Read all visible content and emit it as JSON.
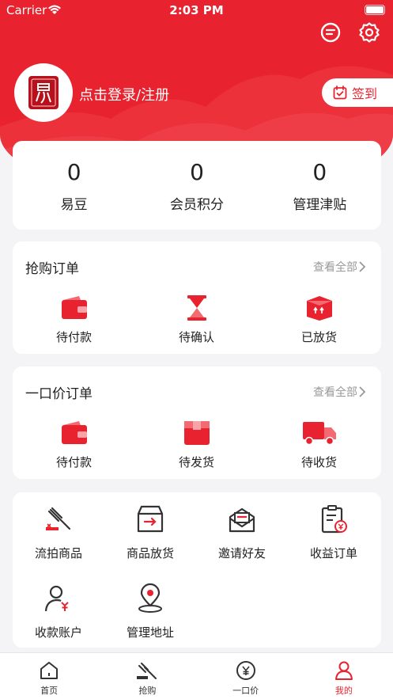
{
  "status": {
    "carrier": "Carrier",
    "time": "2:03 PM"
  },
  "colors": {
    "brand": "#e8232f",
    "background": "#f4f4f6"
  },
  "header": {
    "message_icon": "message-icon",
    "settings_icon": "gear-icon",
    "login_text": "点击登录/注册",
    "signin_label": "签到"
  },
  "stats": [
    {
      "value": "0",
      "label": "易豆"
    },
    {
      "value": "0",
      "label": "会员积分"
    },
    {
      "value": "0",
      "label": "管理津贴"
    }
  ],
  "flash_orders": {
    "title": "抢购订单",
    "view_all": "查看全部",
    "items": [
      {
        "label": "待付款",
        "icon": "wallet-icon"
      },
      {
        "label": "待确认",
        "icon": "hourglass-icon"
      },
      {
        "label": "已放货",
        "icon": "box-icon"
      }
    ]
  },
  "fixed_orders": {
    "title": "一口价订单",
    "view_all": "查看全部",
    "items": [
      {
        "label": "待付款",
        "icon": "wallet-icon"
      },
      {
        "label": "待发货",
        "icon": "package-icon"
      },
      {
        "label": "待收货",
        "icon": "truck-icon"
      }
    ]
  },
  "tools": [
    {
      "label": "流拍商品",
      "icon": "gavel-icon"
    },
    {
      "label": "商品放货",
      "icon": "release-icon"
    },
    {
      "label": "邀请好友",
      "icon": "invite-icon"
    },
    {
      "label": "收益订单",
      "icon": "earnings-icon"
    },
    {
      "label": "收款账户",
      "icon": "account-icon"
    },
    {
      "label": "管理地址",
      "icon": "location-icon"
    }
  ],
  "tabbar": [
    {
      "label": "首页",
      "icon": "home-icon",
      "active": false
    },
    {
      "label": "抢购",
      "icon": "auction-icon",
      "active": false
    },
    {
      "label": "一口价",
      "icon": "yen-icon",
      "active": false
    },
    {
      "label": "我的",
      "icon": "profile-icon",
      "active": true
    }
  ]
}
